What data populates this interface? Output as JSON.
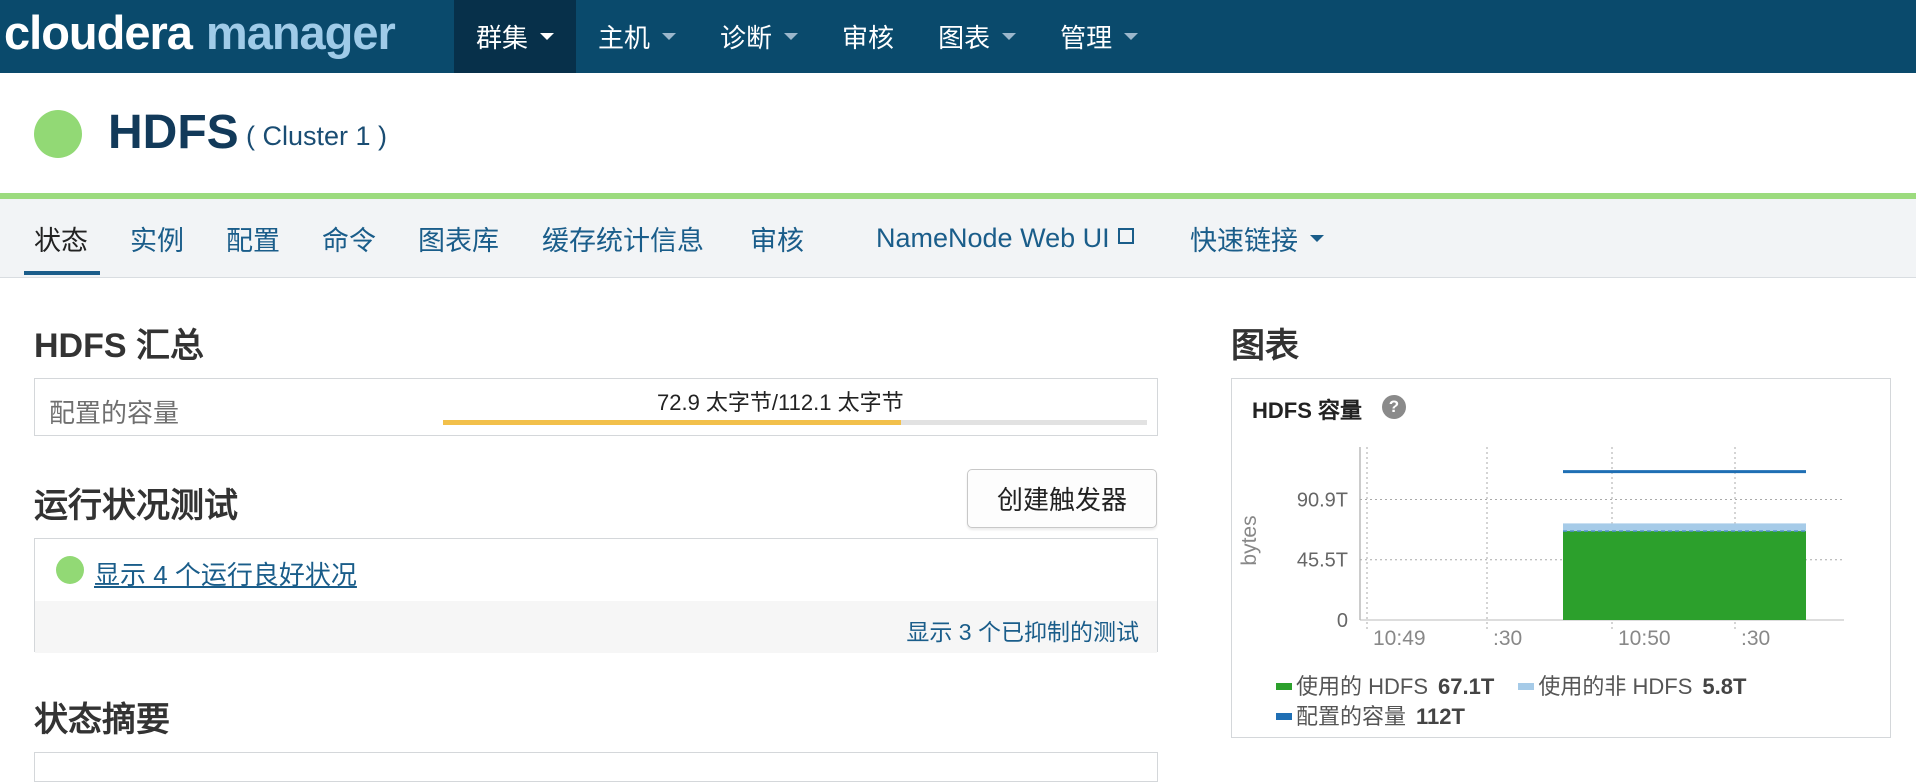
{
  "topnav": {
    "logo_part1": "cloudera",
    "logo_part2": "manager",
    "items": [
      {
        "label": "群集",
        "dropdown": true,
        "active": true
      },
      {
        "label": "主机",
        "dropdown": true
      },
      {
        "label": "诊断",
        "dropdown": true
      },
      {
        "label": "审核",
        "dropdown": false
      },
      {
        "label": "图表",
        "dropdown": true
      },
      {
        "label": "管理",
        "dropdown": true
      }
    ]
  },
  "service": {
    "name": "HDFS",
    "cluster": "( Cluster 1 )",
    "status_color": "#92d975"
  },
  "tabs": [
    {
      "label": "状态",
      "active": true
    },
    {
      "label": "实例"
    },
    {
      "label": "配置"
    },
    {
      "label": "命令"
    },
    {
      "label": "图表库"
    },
    {
      "label": "缓存统计信息"
    },
    {
      "label": "审核"
    },
    {
      "label": "NameNode Web UI",
      "external": true
    },
    {
      "label": "快速链接",
      "dropdown": true
    }
  ],
  "summary": {
    "heading": "HDFS 汇总",
    "capacity_label": "配置的容量",
    "capacity_value": "72.9 太字节/112.1 太字节",
    "capacity_used_fraction": 0.65
  },
  "health": {
    "heading": "运行状况测试",
    "create_trigger_label": "创建触发器",
    "good_link": "显示 4 个运行良好状况",
    "suppressed_link": "显示 3 个已抑制的测试"
  },
  "status_summary": {
    "heading": "状态摘要"
  },
  "charts": {
    "heading": "图表",
    "panel_title": "HDFS 容量",
    "help_glyph": "?"
  },
  "chart_data": {
    "type": "area",
    "title": "HDFS 容量",
    "ylabel": "bytes",
    "x_ticks": [
      "10:49",
      ":30",
      "10:50",
      ":30"
    ],
    "y_ticks": [
      "0",
      "45.5T",
      "90.9T"
    ],
    "ylim": [
      0,
      120
    ],
    "grid": true,
    "legend_position": "bottom",
    "series": [
      {
        "name": "使用的 HDFS",
        "color": "#2ca02c",
        "value_label": "67.1T",
        "value": 67.1
      },
      {
        "name": "使用的非 HDFS",
        "color": "#a6cbe8",
        "value_label": "5.8T",
        "value": 5.8
      },
      {
        "name": "配置的容量",
        "color": "#1f6fb4",
        "value_label": "112T",
        "value": 112
      }
    ]
  }
}
